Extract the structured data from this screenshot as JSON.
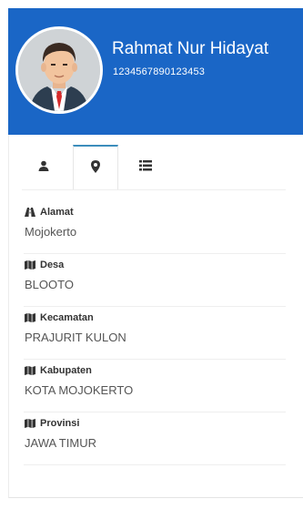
{
  "user": {
    "name": "Rahmat Nur Hidayat",
    "id_number": "1234567890123453"
  },
  "colors": {
    "header": "#1a66c6",
    "tab_active_border": "#3c8dbc"
  },
  "tabs": [
    {
      "icon": "user-icon",
      "active": false
    },
    {
      "icon": "map-marker-icon",
      "active": true
    },
    {
      "icon": "list-icon",
      "active": false
    }
  ],
  "details": [
    {
      "icon": "road-icon",
      "label": "Alamat",
      "value": "Mojokerto"
    },
    {
      "icon": "map-icon",
      "label": "Desa",
      "value": "BLOOTO"
    },
    {
      "icon": "map-icon",
      "label": "Kecamatan",
      "value": "PRAJURIT KULON"
    },
    {
      "icon": "map-icon",
      "label": "Kabupaten",
      "value": "KOTA MOJOKERTO"
    },
    {
      "icon": "map-icon",
      "label": "Provinsi",
      "value": "JAWA TIMUR"
    }
  ]
}
